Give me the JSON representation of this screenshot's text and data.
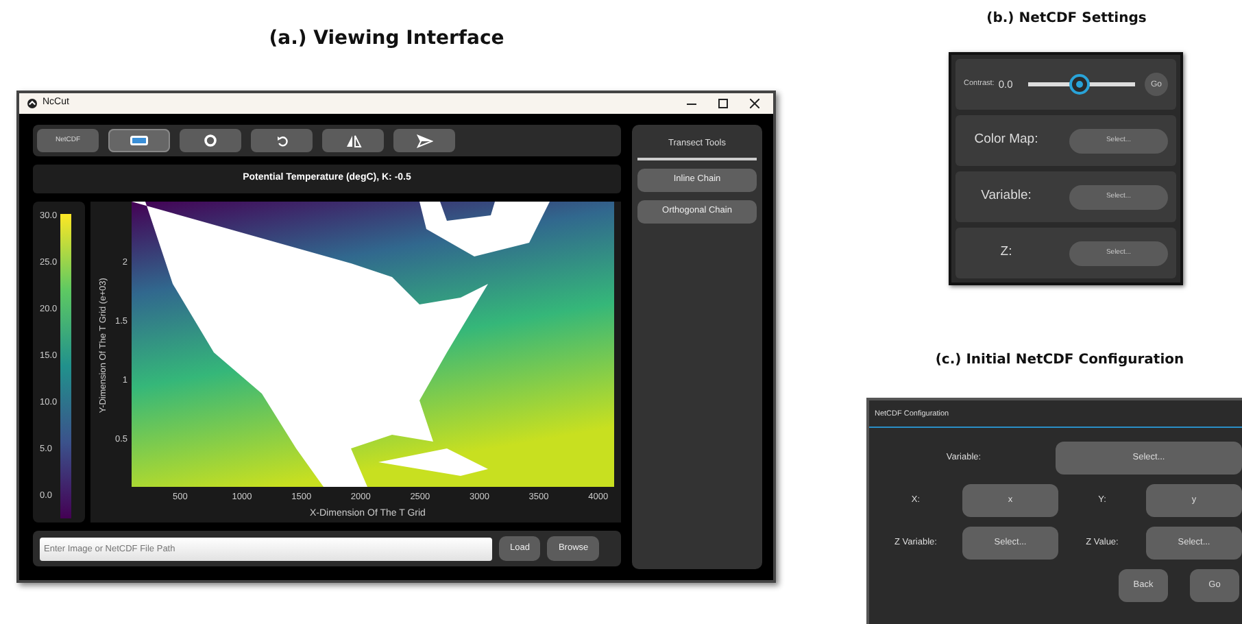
{
  "viewing_interface": {
    "caption": "(a.) Viewing Interface",
    "window": {
      "title": "NcCut",
      "toolbar": [
        {
          "kind": "text",
          "label": "NetCDF",
          "selected": false
        },
        {
          "kind": "rectangle",
          "selected": true
        },
        {
          "kind": "circle",
          "selected": false
        },
        {
          "kind": "rotate",
          "selected": false
        },
        {
          "kind": "mirror",
          "selected": false
        },
        {
          "kind": "send",
          "selected": false
        }
      ],
      "plot_title": "Potential Temperature (degC), K: -0.5",
      "colorbar_ticks": [
        "30.0",
        "25.0",
        "20.0",
        "15.0",
        "10.0",
        "5.0",
        "0.0"
      ],
      "plot": {
        "ylabel": "Y-Dimension Of The T Grid (e+03)",
        "yticks": [
          "2",
          "1.5",
          "1",
          "0.5"
        ],
        "xticks": [
          "500",
          "1000",
          "1500",
          "2000",
          "2500",
          "3000",
          "3500",
          "4000"
        ],
        "xlabel": "X-Dimension Of The T Grid"
      },
      "file_path": {
        "placeholder": "Enter Image or NetCDF File Path"
      },
      "buttons": [
        "Load",
        "Browse"
      ],
      "sidebar": {
        "title": "Transect Tools",
        "buttons": [
          "Inline Chain",
          "Orthogonal Chain"
        ]
      }
    }
  },
  "netcdf_settings": {
    "caption": "(b.) NetCDF Settings",
    "contrast": {
      "label": "Contrast:",
      "value": "0.0",
      "level": 0.48
    },
    "go_button": "Go",
    "rows": [
      {
        "label": "Color Map:",
        "value": "Select..."
      },
      {
        "label": "Variable:",
        "value": "Select..."
      },
      {
        "label": "Z:",
        "value": "Select..."
      }
    ]
  },
  "initial_config": {
    "caption": "(c.) Initial NetCDF Configuration",
    "title": "NetCDF Configuration",
    "variable": {
      "label": "Variable:",
      "value": "Select..."
    },
    "pairs": [
      {
        "label": "X:",
        "value": "x"
      },
      {
        "label": "Y:",
        "value": "y"
      },
      {
        "label": "Z Variable:",
        "value": "Select..."
      },
      {
        "label": "Z Value:",
        "value": "Select..."
      }
    ],
    "buttons": [
      "Back",
      "Go"
    ]
  }
}
